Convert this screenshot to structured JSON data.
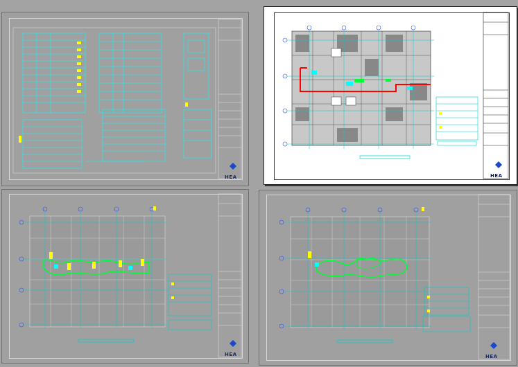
{
  "sheets": [
    {
      "id": "legend",
      "logo": "HEA",
      "active": false
    },
    {
      "id": "floor-plan-1",
      "logo": "HEA",
      "active": true
    },
    {
      "id": "floor-plan-2",
      "logo": "HEA",
      "active": false
    },
    {
      "id": "floor-plan-3",
      "logo": "HEA",
      "active": false
    }
  ],
  "colors": {
    "background": "#a3a3a3",
    "cyan": "#00ffff",
    "yellow": "#ffff00",
    "green": "#00ff33",
    "red": "#ff0000",
    "grid_blue": "#3050ff"
  }
}
